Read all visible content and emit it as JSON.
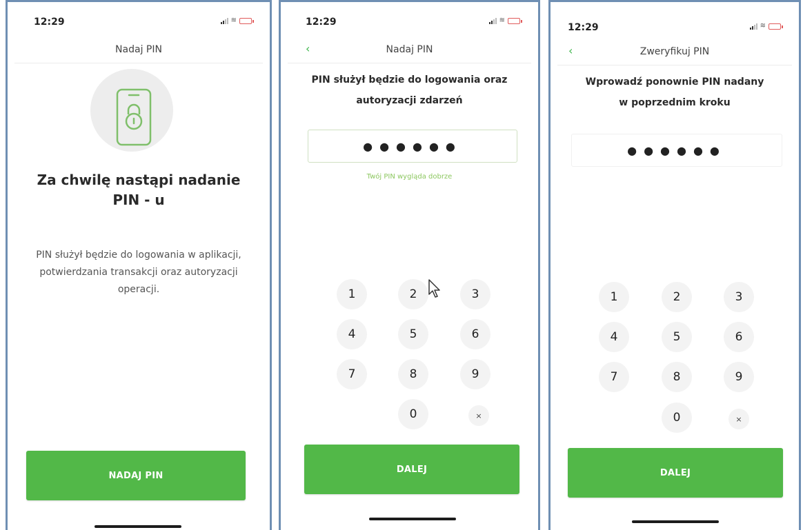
{
  "screens": [
    {
      "status": {
        "time": "12:29"
      },
      "nav_title": "Nadaj PIN",
      "headline": "Za chwilę nastąpi nadanie PIN - u",
      "description": "PIN służył będzie do logowania w aplikacji, potwierdzania transakcji oraz autoryzacji operacji.",
      "button_label": "NADAJ PIN",
      "icons": {
        "illustration": "phone-lock-icon"
      }
    },
    {
      "status": {
        "time": "12:29"
      },
      "nav_title": "Nadaj PIN",
      "prompt_line1": "PIN służył będzie do logowania oraz",
      "prompt_line2": "autoryzacji zdarzeń",
      "pin_value": "●●●●●●",
      "hint": "Twój PIN wygląda dobrze",
      "keys": [
        "1",
        "2",
        "3",
        "4",
        "5",
        "6",
        "7",
        "8",
        "9",
        "0",
        "×"
      ],
      "button_label": "DALEJ"
    },
    {
      "status": {
        "time": "12:29"
      },
      "nav_title": "Zweryfikuj PIN",
      "prompt_line1": "Wprowadź ponownie PIN nadany",
      "prompt_line2": "w poprzednim kroku",
      "pin_value": "●●●●●●",
      "keys": [
        "1",
        "2",
        "3",
        "4",
        "5",
        "6",
        "7",
        "8",
        "9",
        "0",
        "×"
      ],
      "button_label": "DALEJ"
    }
  ],
  "colors": {
    "accent_green": "#52b848",
    "hint_green": "#8cc75f",
    "frame_blue": "#6f8fb3",
    "key_bg": "#f3f3f3"
  }
}
